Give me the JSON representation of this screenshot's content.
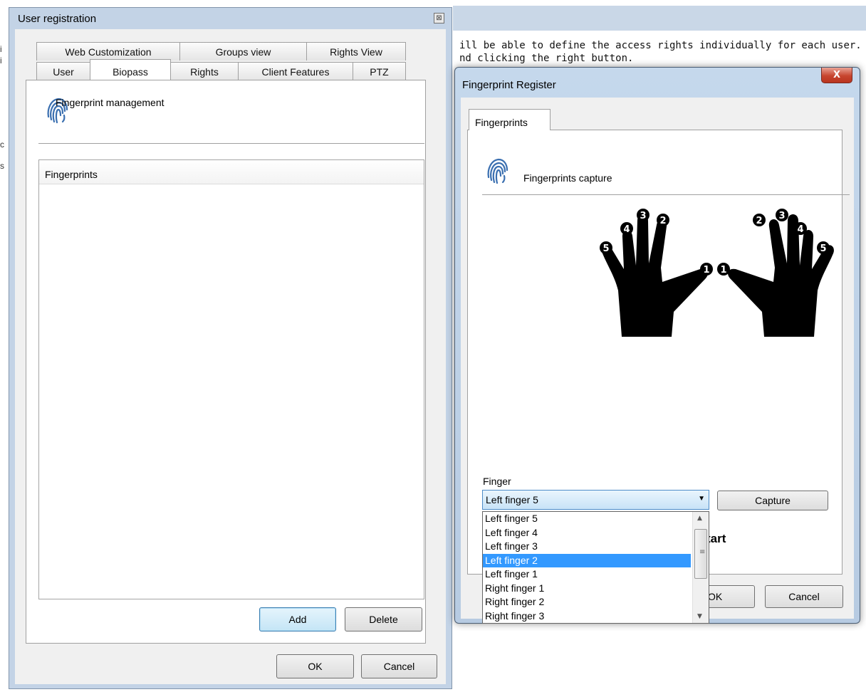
{
  "background": {
    "text_lines": [
      "ill be able to define the access rights individually for each user. It´s",
      "nd clicking the right button."
    ],
    "left_edge_glyphs": [
      "i",
      "i",
      "c",
      "s"
    ]
  },
  "user_registration": {
    "title": "User registration",
    "close_glyph": "⊠",
    "tabs_top": [
      "Web Customization",
      "Groups view",
      "Rights View"
    ],
    "tabs_bottom": [
      "User",
      "Biopass",
      "Rights",
      "Client Features",
      "PTZ"
    ],
    "selected_tab": "Biopass",
    "section_title": "Fingerprint management",
    "list_header": "Fingerprints",
    "add_label": "Add",
    "delete_label": "Delete",
    "ok_label": "OK",
    "cancel_label": "Cancel"
  },
  "fingerprint_register": {
    "title": "Fingerprint Register",
    "close_glyph": "X",
    "tab_label": "Fingerprints",
    "section_title": "Fingerprints capture",
    "finger_label": "Finger",
    "selected_finger": "Left finger 5",
    "capture_label": "Capture",
    "ok_label": "OK",
    "cancel_label": "Cancel",
    "partial_text": "tart",
    "hand_finger_numbers": {
      "left": [
        "5",
        "4",
        "3",
        "2",
        "1"
      ],
      "right": [
        "1",
        "2",
        "3",
        "4",
        "5"
      ]
    },
    "dropdown_options": [
      "Left finger 5",
      "Left finger 4",
      "Left finger 3",
      "Left finger 2",
      "Left finger 1",
      "Right finger 1",
      "Right finger 2",
      "Right finger 3"
    ],
    "highlighted_option": "Left finger 2"
  },
  "colors": {
    "highlight": "#3399ff",
    "window_frame": "#c3d3e6",
    "close_red": "#c7452f"
  }
}
